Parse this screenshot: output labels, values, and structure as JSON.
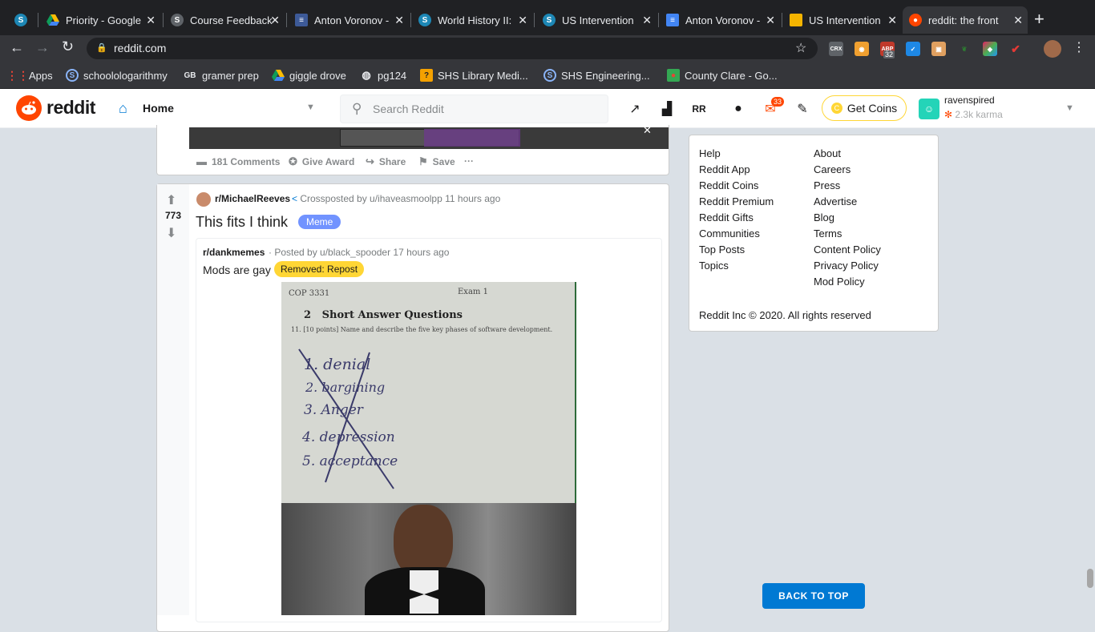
{
  "browser": {
    "tabs": [
      {
        "label": "",
        "icon": "schoology-icon"
      },
      {
        "label": "Priority - Google",
        "icon": "google-drive-icon"
      },
      {
        "label": "Course Feedback",
        "icon": "schoology-icon"
      },
      {
        "label": "Anton Voronov -",
        "icon": "google-docs-icon"
      },
      {
        "label": "World History II:",
        "icon": "schoology-icon"
      },
      {
        "label": "US Intervention",
        "icon": "schoology-icon"
      },
      {
        "label": "Anton Voronov -",
        "icon": "google-docs-icon"
      },
      {
        "label": "US Intervention",
        "icon": "google-slides-icon"
      },
      {
        "label": "reddit: the front",
        "icon": "reddit-icon"
      }
    ],
    "new_tab_label": "+",
    "url": "reddit.com",
    "bookmarks": [
      {
        "label": "Apps",
        "icon": "apps-grid-icon"
      },
      {
        "label": "schoolologarithmy",
        "icon": "schoology-icon"
      },
      {
        "label": "gramer prep",
        "icon": "gb-icon"
      },
      {
        "label": "giggle drove",
        "icon": "google-drive-icon"
      },
      {
        "label": "pg124",
        "icon": "globe-icon"
      },
      {
        "label": "SHS Library Medi...",
        "icon": "library-icon"
      },
      {
        "label": "SHS Engineering...",
        "icon": "schoology-icon"
      },
      {
        "label": "County Clare - Go...",
        "icon": "google-maps-icon"
      }
    ],
    "extensions": [
      {
        "icon": "crx-icon",
        "label": "CRX"
      },
      {
        "icon": "owl-icon",
        "label": ""
      },
      {
        "icon": "abp-icon",
        "label": "ABP",
        "badge": "32"
      },
      {
        "icon": "ext-blue-icon",
        "label": ""
      },
      {
        "icon": "ext-box-icon",
        "label": ""
      },
      {
        "icon": "ext-leaf-icon",
        "label": ""
      },
      {
        "icon": "ext-color-icon",
        "label": ""
      },
      {
        "icon": "ext-red-icon",
        "label": ""
      }
    ]
  },
  "reddit_header": {
    "logo_text": "reddit",
    "home_label": "Home",
    "search_placeholder": "Search Reddit",
    "notifications_badge": "33",
    "get_coins_label": "Get Coins",
    "username": "ravenspired",
    "karma": "2.3k karma"
  },
  "prev_post": {
    "comments": "181 Comments",
    "give_award": "Give Award",
    "share": "Share",
    "save": "Save",
    "more": "···"
  },
  "post": {
    "votes": "773",
    "subreddit": "r/MichaelReeves",
    "crosspost_text": "Crossposted by u/ihaveasmoolpp 11 hours ago",
    "title": "This fits I think",
    "flair": "Meme",
    "embedded": {
      "subreddit": "r/dankmemes",
      "posted_by": "· Posted by u/black_spooder 17 hours ago",
      "title": "Mods are gay",
      "flair": "Removed: Repost",
      "image": {
        "header_left": "COP 3331",
        "header_right": "Exam 1",
        "section": "2   Short Answer Questions",
        "question": "11.  [10 points]  Name and describe the five key phases of software development.",
        "answers": [
          "1. denial",
          "2. bargining",
          "3. Anger",
          "4. depression",
          "5. acceptance"
        ]
      }
    }
  },
  "footer": {
    "col1": [
      "Help",
      "Reddit App",
      "Reddit Coins",
      "Reddit Premium",
      "Reddit Gifts",
      "Communities",
      "Top Posts",
      "Topics"
    ],
    "col2": [
      "About",
      "Careers",
      "Press",
      "Advertise",
      "Blog",
      "Terms",
      "Content Policy",
      "Privacy Policy",
      "Mod Policy"
    ],
    "copyright": "Reddit Inc © 2020. All rights reserved"
  },
  "back_to_top": "BACK TO TOP",
  "colors": {
    "reddit_orange": "#ff4500",
    "blue": "#0079d3",
    "meme_flair": "#7193ff",
    "removed_flair": "#ffd635"
  }
}
